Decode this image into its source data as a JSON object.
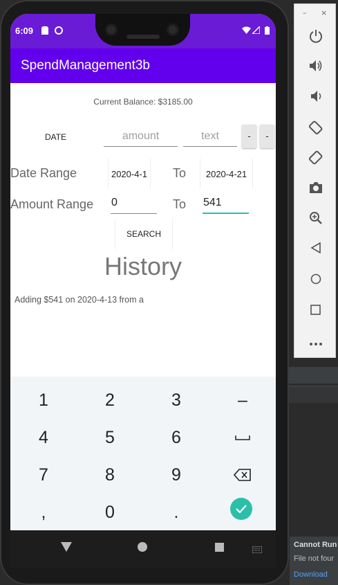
{
  "status_bar": {
    "time": "6:09",
    "left_icons": [
      "sd-card-icon",
      "data-saver-icon"
    ],
    "right_icons": [
      "wifi-icon",
      "signal-icon",
      "battery-icon"
    ]
  },
  "app": {
    "title": "SpendManagement3b",
    "accent": "#6200ee",
    "status_color": "#6a1bd6"
  },
  "main": {
    "balance": "Current Balance: $3185.00",
    "date_button": "DATE",
    "amount_placeholder": "amount",
    "text_placeholder": "text",
    "small_button_1": "-",
    "small_button_2": "-",
    "date_range_label": "Date Range",
    "date_from": "2020-4-1",
    "to_label_1": "To",
    "date_to": "2020-4-21",
    "amount_range_label": "Amount Range",
    "amount_from": "0",
    "to_label_2": "To",
    "amount_to": "541",
    "search_button": "SEARCH",
    "history_heading": "History",
    "history_entries": [
      "Adding $541 on 2020-4-13 from a"
    ]
  },
  "keyboard": {
    "rows": [
      [
        "1",
        "2",
        "3",
        "–"
      ],
      [
        "4",
        "5",
        "6",
        "␣"
      ],
      [
        "7",
        "8",
        "9",
        "⌫"
      ],
      [
        ",",
        "0",
        ".",
        "✓"
      ]
    ],
    "confirm_color": "#2bbfaa"
  },
  "emulator_sidebar": {
    "close": "×",
    "minimize": "–",
    "buttons": [
      "power-icon",
      "volume-up-icon",
      "volume-down-icon",
      "rotate-left-icon",
      "rotate-right-icon",
      "camera-icon",
      "zoom-icon",
      "back-icon",
      "home-icon",
      "overview-icon",
      "more-icon"
    ]
  },
  "notification": {
    "title": "Cannot Run",
    "message": "File not four",
    "link": "Download"
  }
}
